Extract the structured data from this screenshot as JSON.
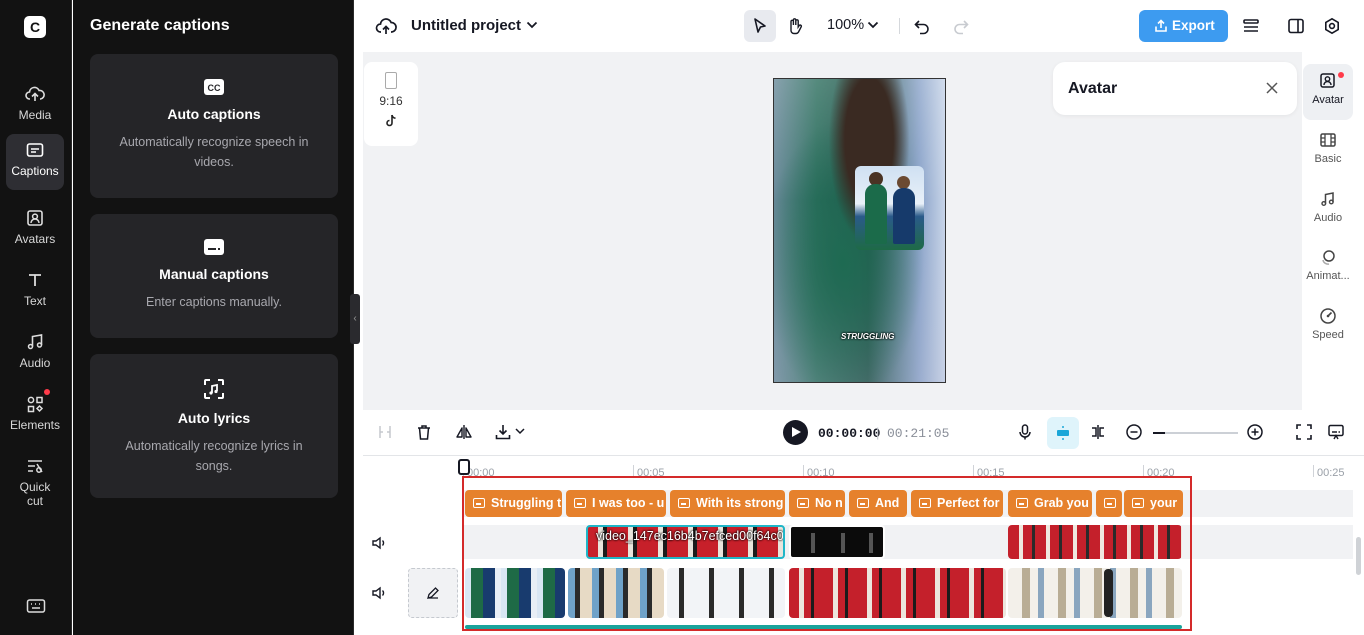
{
  "left_rail": {
    "logo": "C",
    "items": [
      {
        "label": "Media",
        "icon": "cloud-upload-icon"
      },
      {
        "label": "Captions",
        "icon": "captions-icon",
        "active": true
      },
      {
        "label": "Avatars",
        "icon": "avatar-icon"
      },
      {
        "label": "Text",
        "icon": "text-icon"
      },
      {
        "label": "Audio",
        "icon": "music-note-icon"
      },
      {
        "label": "Elements",
        "icon": "elements-icon",
        "badge": true
      },
      {
        "label": "Quick cut",
        "icon": "quick-cut-icon"
      }
    ],
    "keyboard_icon": "keyboard-icon"
  },
  "panel": {
    "title": "Generate captions",
    "cards": [
      {
        "title": "Auto captions",
        "desc": "Automatically recognize speech in videos.",
        "icon": "cc-icon"
      },
      {
        "title": "Manual captions",
        "desc": "Enter captions manually.",
        "icon": "subtitle-icon"
      },
      {
        "title": "Auto lyrics",
        "desc": "Automatically recognize lyrics in songs.",
        "icon": "lyrics-scan-icon"
      }
    ]
  },
  "topbar": {
    "project_title": "Untitled project",
    "zoom": "100%",
    "export_label": "Export"
  },
  "stage": {
    "aspect_ratio": "9:16",
    "caption_overlay": "STRUGGLING",
    "avatar_panel_title": "Avatar"
  },
  "right_tools": [
    {
      "label": "Avatar",
      "icon": "avatar-add-icon",
      "active": true,
      "badge": true
    },
    {
      "label": "Basic",
      "icon": "film-icon"
    },
    {
      "label": "Audio",
      "icon": "music-note-icon"
    },
    {
      "label": "Animat...",
      "icon": "animation-icon"
    },
    {
      "label": "Speed",
      "icon": "speed-icon"
    }
  ],
  "timeline": {
    "current_time": "00:00:00",
    "total_time": "00:21:05",
    "ruler": [
      "00:00",
      "00:05",
      "00:10",
      "00:15",
      "00:20",
      "00:25"
    ],
    "captions": [
      "Struggling t",
      "I was too - u",
      "With its strong",
      "No n",
      "And",
      "Perfect for",
      "Grab you",
      "",
      "your"
    ],
    "video_clip_name": "video_147ec16b4b7efced00f64c0"
  },
  "colors": {
    "accent": "#3d9bf0",
    "caption_clip": "#e6812c",
    "selection_border": "#d42a2a",
    "rail_bg": "#121212"
  }
}
